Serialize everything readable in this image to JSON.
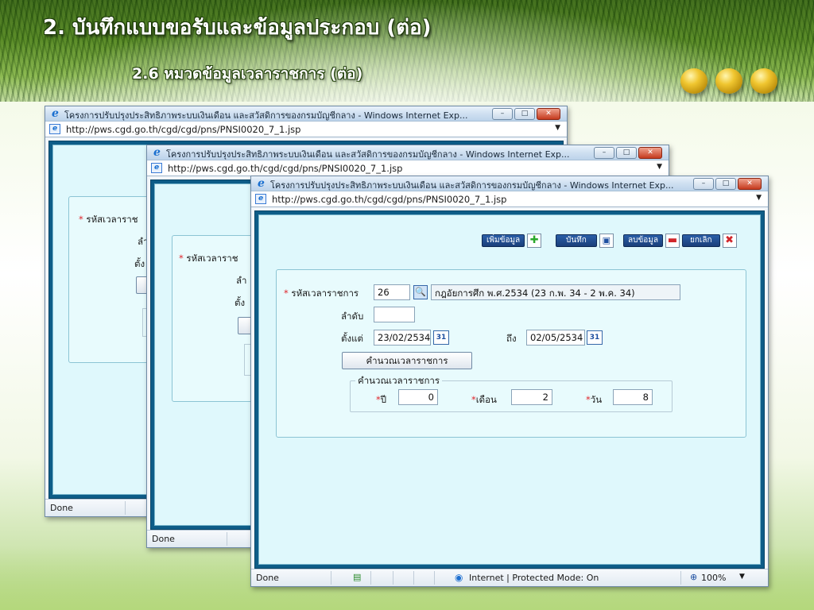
{
  "slide": {
    "title": "2. บันทึกแบบขอรับและข้อมูลประกอบ (ต่อ)",
    "subtitle": "2.6 หมวดข้อมูลเวลาราชการ (ต่อ)"
  },
  "browser": {
    "window_title": "โครงการปรับปรุงประสิทธิภาพระบบเงินเดือน และสวัสดิการของกรมบัญชีกลาง - Windows Internet Exp...",
    "url": "http://pws.cgd.go.th/cgd/cgd/pns/PNSI0020_7_1.jsp",
    "url_partial_mid": "http://pws.cgd.go.th/cgd/cgd/pns/PNSI0020_7_1.jsp",
    "status_done": "Done",
    "status_zone": "Internet | Protected Mode: On",
    "zoom": "100%"
  },
  "toolbar": {
    "add_label": "เพิ่มข้อมูล",
    "save_label": "บันทึก",
    "delete_label": "ลบข้อมูล",
    "cancel_label": "ยกเลิก"
  },
  "form": {
    "code_label": "รหัสเวลาราชการ",
    "code_value": "26",
    "code_desc": "กฎอัยการศึก พ.ศ.2534 (23 ก.พ. 34 - 2 พ.ค. 34)",
    "order_label": "ลำดับ",
    "order_value": "",
    "from_label": "ตั้งแต่",
    "from_value": "23/02/2534",
    "to_label": "ถึง",
    "to_value": "02/05/2534",
    "calc_button": "คำนวณเวลาราชการ",
    "calc_group": "คำนวณเวลาราชการ",
    "year_label": "ปี",
    "year_value": "0",
    "month_label": "เดือน",
    "month_value": "2",
    "day_label": "วัน",
    "day_value": "8",
    "cal_icon_text": "31",
    "bg_code_label_1": "รหัสเวลาราช",
    "bg_code_label_2": "รหัสเวลาราช",
    "bg_order_1": "ลำ",
    "bg_from_1": "ตั้ง",
    "bg_order_2": "ลำ",
    "bg_from_2": "ตั้ง"
  },
  "icons": {
    "ie": "internet-explorer-icon",
    "globe": "globe-icon",
    "zoom": "magnifier-icon"
  },
  "colors": {
    "frame": "#0e5d88",
    "content": "#dff8fc",
    "required": "#e0242a",
    "toolbar_button": "#2b5fa8"
  }
}
